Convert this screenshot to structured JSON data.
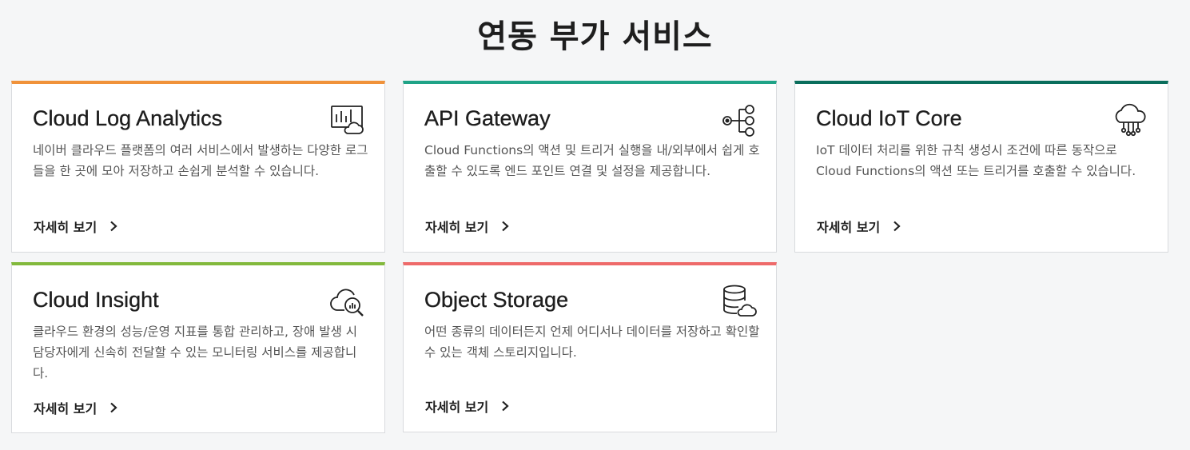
{
  "page": {
    "title": "연동 부가 서비스"
  },
  "colors": {
    "log_analytics": "#f0923a",
    "api_gateway": "#1fa387",
    "iot_core": "#0a6e5c",
    "insight": "#82b93c",
    "object_storage": "#ee6a6a"
  },
  "cards": [
    {
      "title": "Cloud Log Analytics",
      "icon": "log-chart-cloud-icon",
      "description": "네이버 클라우드 플랫폼의 여러 서비스에서 발생하는 다양한 로그들을 한 곳에 모아 저장하고 손쉽게 분석할 수 있습니다.",
      "link": "자세히 보기"
    },
    {
      "title": "API Gateway",
      "icon": "gateway-network-icon",
      "description": "Cloud Functions의 액션 및 트리거 실행을 내/외부에서 쉽게 호출할 수 있도록 엔드 포인트 연결 및 설정을 제공합니다.",
      "link": "자세히 보기"
    },
    {
      "title": "Cloud IoT Core",
      "icon": "iot-cloud-icon",
      "description": "IoT 데이터 처리를 위한 규칙 생성시 조건에 따른 동작으로 Cloud Functions의 액션 또는 트리거를 호출할 수 있습니다.",
      "link": "자세히 보기"
    },
    {
      "title": "Cloud Insight",
      "icon": "cloud-monitor-icon",
      "description": "클라우드 환경의 성능/운영 지표를 통합 관리하고, 장애 발생 시 담당자에게 신속히 전달할 수 있는 모니터링 서비스를 제공합니다.",
      "link": "자세히 보기"
    },
    {
      "title": "Object Storage",
      "icon": "database-cloud-icon",
      "description": "어떤 종류의 데이터든지 언제 어디서나 데이터를 저장하고 확인할 수 있는 객체 스토리지입니다.",
      "link": "자세히 보기"
    }
  ]
}
